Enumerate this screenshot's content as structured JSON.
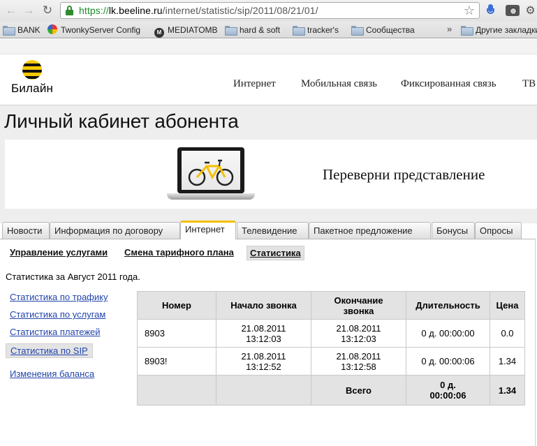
{
  "browser": {
    "url_scheme": "https://",
    "url_host": "lk.beeline.ru",
    "url_path": "/internet/statistic/sip/2011/08/21/01/",
    "bookmarks": [
      "BANK",
      "TwonkyServer Config",
      "MEDIATOMB",
      "hard & soft",
      "tracker's",
      "Сообщества"
    ],
    "other_bookmarks": "Другие закладки"
  },
  "site": {
    "logo_text": "Билайн",
    "main_nav": [
      "Интернет",
      "Мобильная связь",
      "Фиксированная связь",
      "ТВ"
    ],
    "page_title": "Личный кабинет абонента",
    "banner_text": "Переверни представление"
  },
  "tabs": [
    "Новости",
    "Информация по договору",
    "Интернет",
    "Телевидение",
    "Пакетное предложение",
    "Бонусы",
    "Опросы"
  ],
  "subnav": [
    "Управление услугами",
    "Смена тарифного плана",
    "Статистика"
  ],
  "period": "Статистика за Август 2011 года.",
  "side_links": [
    "Статистика по трафику",
    "Статистика по услугам",
    "Статистика платежей",
    "Статистика по SIP",
    "Изменения баланса"
  ],
  "table": {
    "headers": [
      "Номер",
      "Начало звонка",
      "Окончание звонка",
      "Длительность",
      "Цена"
    ],
    "rows": [
      {
        "number": "8903",
        "start": "21.08.2011 13:12:03",
        "end": "21.08.2011 13:12:03",
        "duration": "0 д. 00:00:00",
        "price": "0.0"
      },
      {
        "number": "8903!",
        "start": "21.08.2011 13:12:52",
        "end": "21.08.2011 13:12:58",
        "duration": "0 д. 00:00:06",
        "price": "1.34"
      }
    ],
    "total": {
      "label": "Всего",
      "duration": "0 д. 00:00:06",
      "price": "1.34"
    }
  }
}
